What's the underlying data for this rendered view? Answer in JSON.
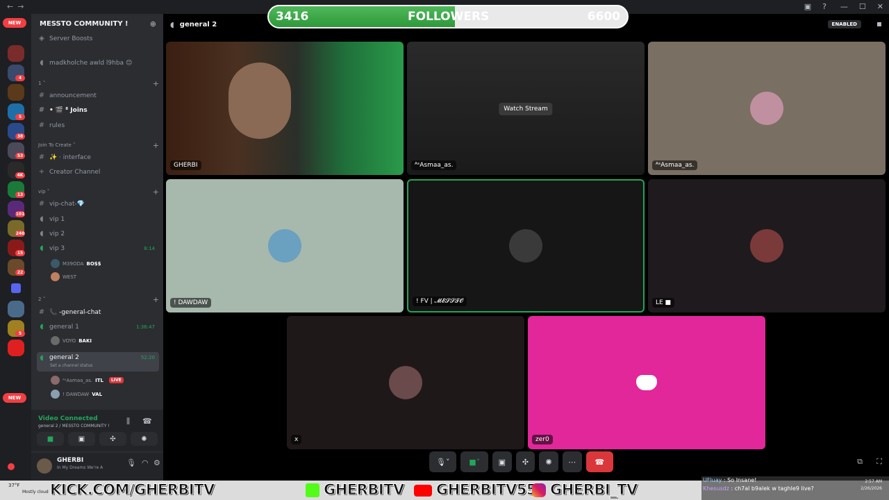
{
  "window": {
    "title": "general 2"
  },
  "rail": {
    "new_top": "NEW",
    "new_bottom": "NEW",
    "badges": [
      "4",
      "5",
      "38",
      "53",
      "4K",
      "13",
      "101",
      "240",
      "15",
      "22",
      "5",
      "1"
    ]
  },
  "server": {
    "name": "MESSTO COMMUNITY !",
    "items": [
      {
        "icon": "rocket-icon",
        "label": "Server Boosts"
      },
      {
        "icon": "speaker-icon",
        "label": "madkholche awld l9hba 😊"
      }
    ],
    "categories": [
      {
        "label": "1",
        "channels": [
          "announcement",
          "• 🎬 ⁸ Joins",
          "rules"
        ]
      },
      {
        "label": "Join To Create",
        "channels": [
          "✨ · interface",
          "Creator Channel"
        ]
      },
      {
        "label": "vip",
        "channels": [
          "vip-chat-💎",
          "vip 1",
          "vip 2",
          "vip 3"
        ]
      },
      {
        "label": "2",
        "channels": [
          "📞 -general-chat",
          "general 1",
          "general 2"
        ]
      }
    ],
    "vip3_time": "8:14",
    "vip3_users": [
      "M39ODA",
      "BO$$",
      "WEST"
    ],
    "general1_time": "1:36:47",
    "general1_users": [
      "VOYO",
      "BAKI"
    ],
    "general2_time": "52:20",
    "general2_status": "Set a channel status",
    "general2_users": [
      "ᴬˢAsmaa_as.",
      "ITL",
      "LIVE",
      "! DAWDAW",
      "VAL"
    ]
  },
  "voice_panel": {
    "status": "Video Connected",
    "location": "general 2 / MESSTO COMMUNITY !"
  },
  "user_panel": {
    "name": "GHERBI",
    "status": "In My Dreams We're A"
  },
  "main": {
    "channel": "general 2",
    "enabled_label": "ENABLED",
    "tiles": [
      {
        "label": "GHERBI"
      },
      {
        "label": "ᴬˢAsmaa_as.",
        "overlay": "Watch Stream"
      },
      {
        "label": "ᴬˢAsmaa_as."
      },
      {
        "label": "! DAWDAW"
      },
      {
        "label": "! FV | 𝓜𝓔𝓢𝓢𝓣𝓞"
      },
      {
        "label": "LE ■"
      },
      {
        "label": "x"
      },
      {
        "label": "zer0"
      }
    ]
  },
  "followers": {
    "current": "3416",
    "label": "FOLLOWERS",
    "goal": "6600",
    "progress": 0.52
  },
  "stream_bar": {
    "kick": "KICK.COM/GHERBITV",
    "handle1": "GHERBITV",
    "handle2": "GHERBITV55",
    "handle3": "GHERBI_TV",
    "weather_temp": "37°F",
    "weather_desc": "Mostly cloud",
    "chat": [
      {
        "user": "UFluay",
        "text": "So Insane!"
      },
      {
        "user": "Khesusdz",
        "text": "ch7al b9alek w taghle9 live?"
      }
    ],
    "time": "2:57 AM",
    "date": "2/26/2026"
  },
  "colors": {
    "accent_green": "#23a55a",
    "discord_pink": "#e1279a",
    "hangup_red": "#da373c",
    "follower_green": "#3fae4a"
  }
}
